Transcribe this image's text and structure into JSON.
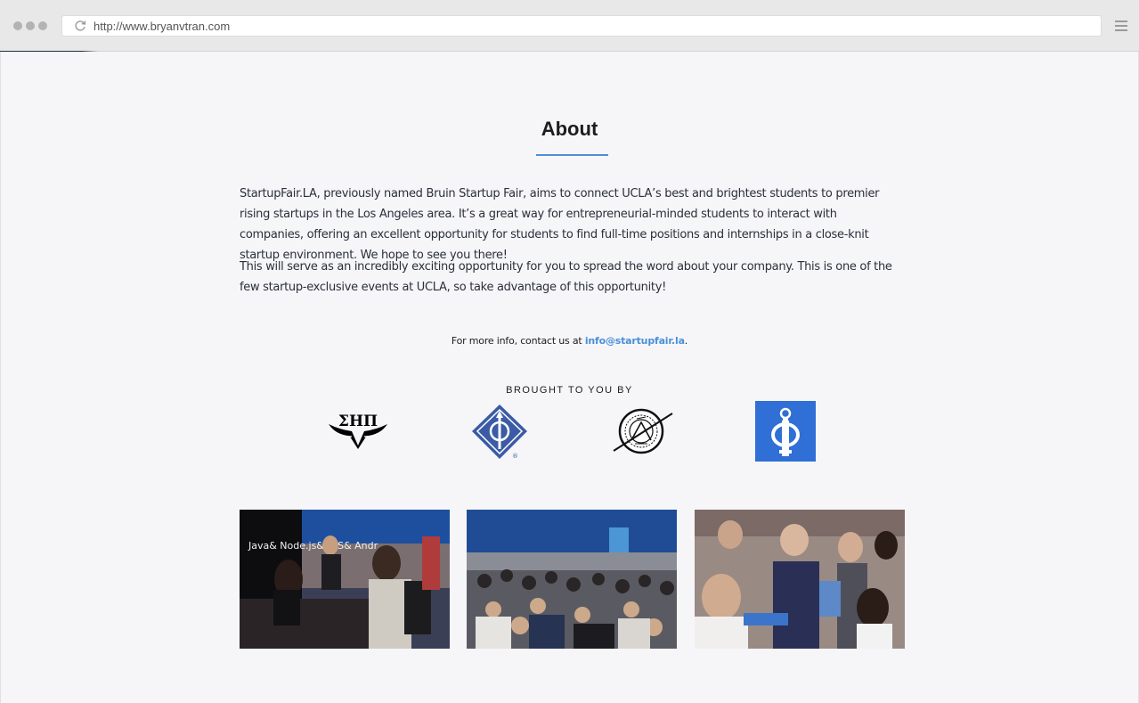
{
  "browser": {
    "url": "http://www.bryanvtran.com"
  },
  "about": {
    "title": "About",
    "paragraph1": "StartupFair.LA, previously named Bruin Startup Fair, aims to connect UCLA’s best and brightest students to premier rising startups in the Los Angeles area. It’s a great way for entrepreneurial-minded students to interact with companies, offering an excellent opportunity for students to find full-time positions and internships in a close-knit startup environment. We hope to see you there!",
    "paragraph2": "This will serve as an incredibly exciting opportunity for you to spread the word about your company. This is one of the few startup-exclusive events at UCLA, so take advantage of this opportunity!",
    "contact_prefix": "For more info, contact us at ",
    "contact_email": "info@startupfair.la",
    "contact_suffix": "."
  },
  "sponsors": {
    "heading": "BROUGHT TO YOU BY",
    "logos": [
      {
        "name": "sigma-eta-pi-logo",
        "text": "ΣΗΠ"
      },
      {
        "name": "ieee-logo",
        "text": "®"
      },
      {
        "name": "asme-logo"
      },
      {
        "name": "blue-org-logo"
      }
    ]
  },
  "photos": [
    {
      "name": "career-fair-booth-photo",
      "banner_text": "Java& Node.js& iOS& Andr"
    },
    {
      "name": "crowded-hall-photo"
    },
    {
      "name": "students-reading-photo"
    }
  ],
  "colors": {
    "accent": "#4a90d9",
    "page_bg": "#f6f6f8",
    "chrome_bg": "#e8e8e8",
    "logo_blue": "#2f6fd6",
    "ieee_blue": "#3b5ba5"
  }
}
